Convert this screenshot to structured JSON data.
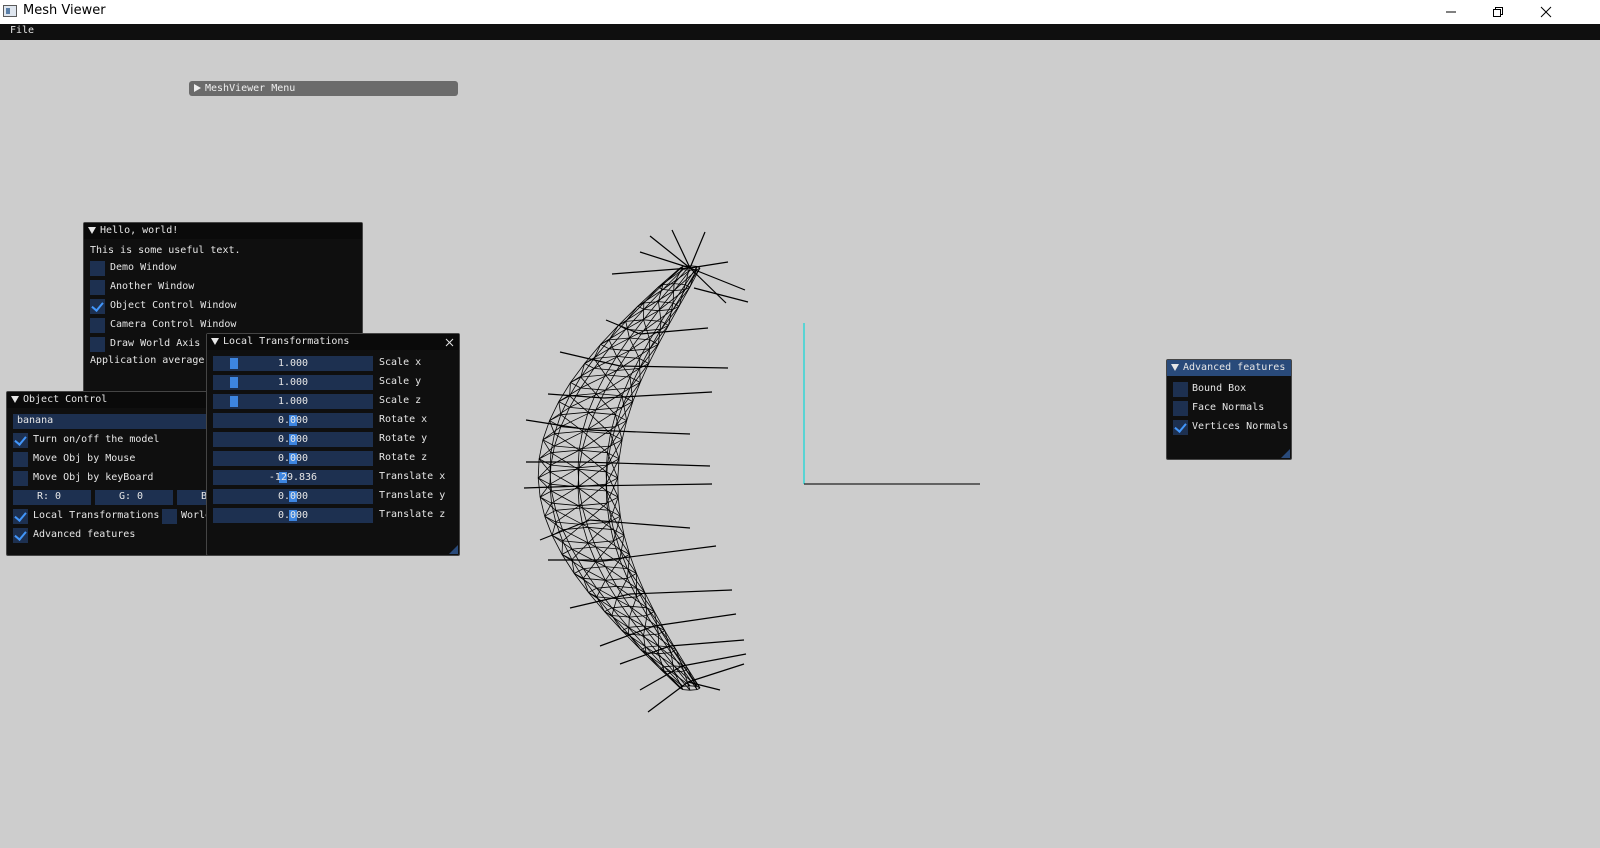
{
  "window": {
    "title": "Mesh Viewer"
  },
  "menubar": {
    "file": "File"
  },
  "meshviewer_menu": {
    "title": "MeshViewer Menu"
  },
  "hello": {
    "title": "Hello, world!",
    "text": "This is some useful text.",
    "checkboxes": [
      {
        "label": "Demo Window",
        "checked": false
      },
      {
        "label": "Another Window",
        "checked": false
      },
      {
        "label": "Object Control Window",
        "checked": true
      },
      {
        "label": "Camera Control Window",
        "checked": false
      },
      {
        "label": "Draw World Axis",
        "checked": false
      }
    ],
    "app_avg": "Application average"
  },
  "object_control": {
    "title": "Object Control",
    "object_name": "banana",
    "checks": [
      {
        "label": "Turn on/off the model",
        "checked": true
      },
      {
        "label": "Move Obj by Mouse",
        "checked": false
      },
      {
        "label": "Move Obj by keyBoard",
        "checked": false
      }
    ],
    "r": "R:  0",
    "g": "G:  0",
    "b": "B",
    "local_transforms": {
      "label": "Local Transformations",
      "checked": true
    },
    "world_transforms": {
      "label": "World",
      "checked": false
    },
    "advanced": {
      "label": "Advanced features",
      "checked": true
    }
  },
  "local_transformations": {
    "title": "Local Transformations",
    "sliders": [
      {
        "label": "Scale x",
        "value": "1.000",
        "fraction": 0.1
      },
      {
        "label": "Scale y",
        "value": "1.000",
        "fraction": 0.1
      },
      {
        "label": "Scale z",
        "value": "1.000",
        "fraction": 0.1
      },
      {
        "label": "Rotate x",
        "value": "0.000",
        "fraction": 0.5
      },
      {
        "label": "Rotate y",
        "value": "0.000",
        "fraction": 0.5
      },
      {
        "label": "Rotate z",
        "value": "0.000",
        "fraction": 0.5
      },
      {
        "label": "Translate x",
        "value": "-129.836",
        "fraction": 0.43
      },
      {
        "label": "Translate y",
        "value": "0.000",
        "fraction": 0.5
      },
      {
        "label": "Translate z",
        "value": "0.000",
        "fraction": 0.5
      }
    ]
  },
  "advanced_features": {
    "title": "Advanced features",
    "checks": [
      {
        "label": "Bound Box",
        "checked": false
      },
      {
        "label": "Face Normals",
        "checked": false
      },
      {
        "label": "Vertices Normals",
        "checked": true
      }
    ]
  },
  "colors": {
    "accent": "#4296fa",
    "frame_bg": "#1d3050",
    "title_active": "#294a7a",
    "viewport_bg": "#cdcdcd",
    "axis_y": "#33d6d6",
    "axis_x": "#222222"
  }
}
